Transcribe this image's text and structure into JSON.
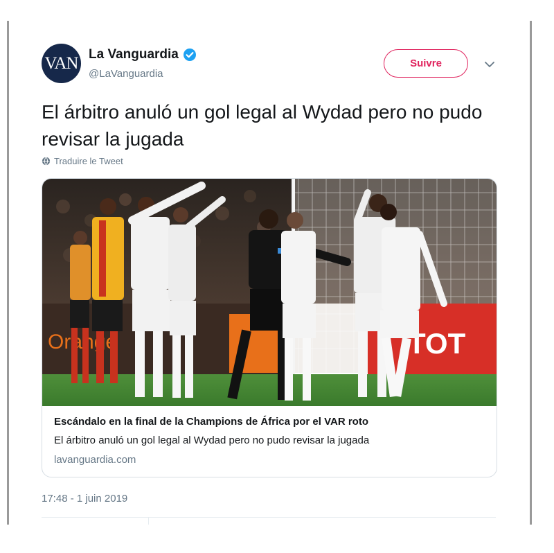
{
  "header": {
    "avatar_text": "VAN",
    "display_name": "La Vanguardia",
    "handle": "@LaVanguardia",
    "follow_label": "Suivre"
  },
  "tweet": {
    "text": "El árbitro anuló un gol legal al Wydad pero no pudo revisar la jugada",
    "translate_label": "Traduire le Tweet",
    "timestamp": "17:48 - 1 juin 2019"
  },
  "card": {
    "title": "Escándalo en la final de la Champions de África por el VAR roto",
    "description": "El árbitro anuló un gol legal al Wydad pero no pudo revisar la jugada",
    "domain": "lavanguardia.com",
    "photo_banner_text": "TOT",
    "photo_banner_text_left": "Orange"
  },
  "colors": {
    "follow_accent": "#e0245e",
    "verified_blue": "#1da1f2",
    "secondary_text": "#657786",
    "primary_text": "#14171a"
  }
}
